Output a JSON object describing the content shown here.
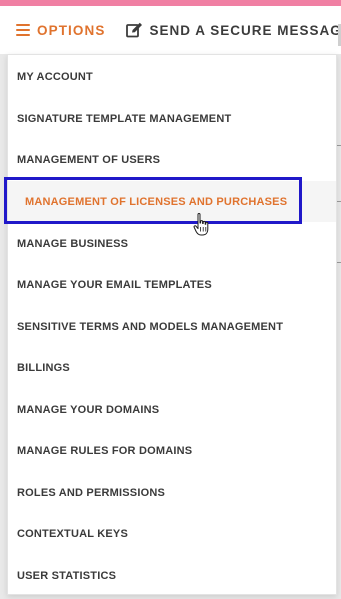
{
  "colors": {
    "accent": "#e0732e",
    "top_bar": "#f07fa3",
    "highlight_border": "#2018c9",
    "text": "#3a3a3a"
  },
  "toolbar": {
    "options_icon": "hamburger-menu-icon",
    "options_label": "OPTIONS",
    "secure_icon": "edit-icon",
    "secure_label": "SEND A SECURE MESSAGE"
  },
  "menu": {
    "items": [
      {
        "label": "MY ACCOUNT"
      },
      {
        "label": "SIGNATURE TEMPLATE MANAGEMENT"
      },
      {
        "label": "MANAGEMENT OF USERS"
      },
      {
        "label": "MANAGEMENT OF LICENSES AND PURCHASES",
        "state": "hovered"
      },
      {
        "label": "MANAGE BUSINESS"
      },
      {
        "label": "MANAGE YOUR EMAIL TEMPLATES"
      },
      {
        "label": "SENSITIVE TERMS AND MODELS MANAGEMENT"
      },
      {
        "label": "BILLINGS"
      },
      {
        "label": "MANAGE YOUR DOMAINS"
      },
      {
        "label": "MANAGE RULES FOR DOMAINS"
      },
      {
        "label": "ROLES AND PERMISSIONS"
      },
      {
        "label": "CONTEXTUAL KEYS"
      },
      {
        "label": "USER STATISTICS"
      }
    ]
  },
  "cursor_icon": "hand-pointer-icon"
}
